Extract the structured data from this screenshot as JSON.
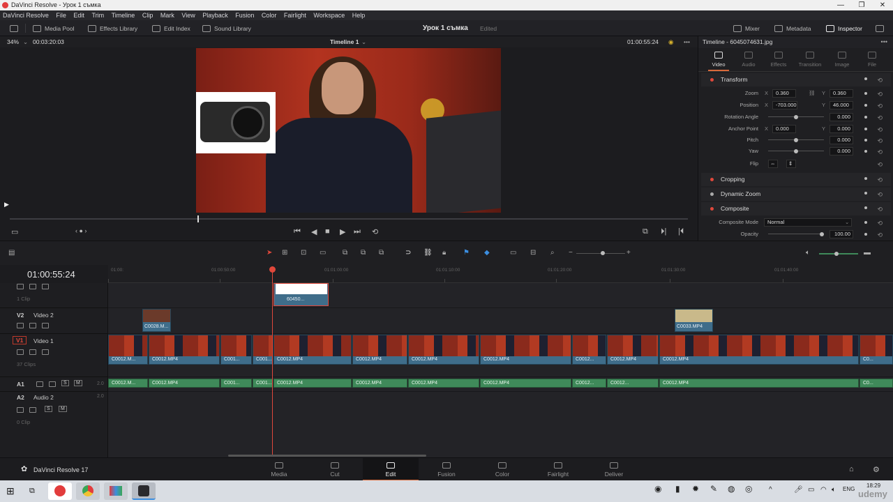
{
  "window": {
    "title": "DaVinci Resolve - Урок 1 съмка",
    "min": "—",
    "max": "❐",
    "close": "✕"
  },
  "menu": [
    "DaVinci Resolve",
    "File",
    "Edit",
    "Trim",
    "Timeline",
    "Clip",
    "Mark",
    "View",
    "Playback",
    "Fusion",
    "Color",
    "Fairlight",
    "Workspace",
    "Help"
  ],
  "toolbar": {
    "media_pool": "Media Pool",
    "effects_library": "Effects Library",
    "edit_index": "Edit Index",
    "sound_library": "Sound Library",
    "project_name": "Урок 1 съмка",
    "project_status": "Edited",
    "mixer": "Mixer",
    "metadata": "Metadata",
    "inspector": "Inspector"
  },
  "viewer": {
    "zoom": "34%",
    "duration": "00:03:20:03",
    "timeline_name": "Timeline 1",
    "timecode": "01:00:55:24",
    "more": "•••"
  },
  "inspector": {
    "title": "Timeline - 6045074631.jpg",
    "tabs": [
      {
        "label": "Video",
        "active": true
      },
      {
        "label": "Audio",
        "active": false
      },
      {
        "label": "Effects",
        "active": false
      },
      {
        "label": "Transition",
        "active": false
      },
      {
        "label": "Image",
        "active": false
      },
      {
        "label": "File",
        "active": false
      }
    ],
    "transform": {
      "header": "Transform",
      "zoom_label": "Zoom",
      "zoom_x": "0.360",
      "zoom_y": "0.360",
      "position_label": "Position",
      "position_x": "-703.000",
      "position_y": "46.000",
      "rotation_label": "Rotation Angle",
      "rotation": "0.000",
      "anchor_label": "Anchor Point",
      "anchor_x": "0.000",
      "anchor_y": "0.000",
      "pitch_label": "Pitch",
      "pitch": "0.000",
      "yaw_label": "Yaw",
      "yaw": "0.000",
      "flip_label": "Flip",
      "x": "X",
      "y": "Y"
    },
    "cropping": "Cropping",
    "dynamic_zoom": "Dynamic Zoom",
    "composite": "Composite",
    "composite_mode_label": "Composite Mode",
    "composite_mode": "Normal",
    "opacity_label": "Opacity",
    "opacity": "100.00"
  },
  "timeline": {
    "timecode": "01:00:55:24",
    "ruler": [
      "01:00:",
      "01:00:50:00",
      "01:01:00:00",
      "01:01:10:00",
      "01:01:20:00",
      "01:01:30:00",
      "01:01:40:00"
    ],
    "tracks": {
      "v3_clips": "1 Clip",
      "v2_id": "V2",
      "v2_name": "Video 2",
      "v1_id": "V1",
      "v1_name": "Video 1",
      "v1_clips": "37 Clips",
      "a1_id": "A1",
      "a1_level": "2.0",
      "a2_id": "A2",
      "a2_name": "Audio 2",
      "a2_level": "2.0",
      "a2_clips": "0 Clip",
      "s": "S",
      "m": "M"
    },
    "clip_overlay": "60450...",
    "clip_v2a": "C0028.M...",
    "clip_v2b": "C0033.MP4",
    "v1_clips": [
      "C0012.M...",
      "C0012.MP4",
      "C001...",
      "C001...",
      "C0012.MP4",
      "C0012.MP4",
      "C0012.MP4",
      "C0012.MP4",
      "C0012...",
      "C0012.MP4",
      "C0012.MP4",
      "C0..."
    ],
    "a1_clips": [
      "C0012.M...",
      "C0012.MP4",
      "C001...",
      "C001...",
      "C0012.MP4",
      "C0012.MP4",
      "C0012.MP4",
      "C0012.MP4",
      "C0012...",
      "C0012...",
      "C0012.MP4",
      "C0..."
    ]
  },
  "pages": {
    "app_name": "DaVinci Resolve 17",
    "items": [
      {
        "label": "Media",
        "active": false
      },
      {
        "label": "Cut",
        "active": false
      },
      {
        "label": "Edit",
        "active": true
      },
      {
        "label": "Fusion",
        "active": false
      },
      {
        "label": "Color",
        "active": false
      },
      {
        "label": "Fairlight",
        "active": false
      },
      {
        "label": "Deliver",
        "active": false
      }
    ]
  },
  "taskbar": {
    "lang": "ENG",
    "time": "18:29",
    "watermark": "udemy"
  },
  "colors": {
    "accent": "#d96a3a",
    "playhead": "#e0483b",
    "video_clip": "#3f6d8a",
    "audio_clip": "#3f8a5a"
  }
}
